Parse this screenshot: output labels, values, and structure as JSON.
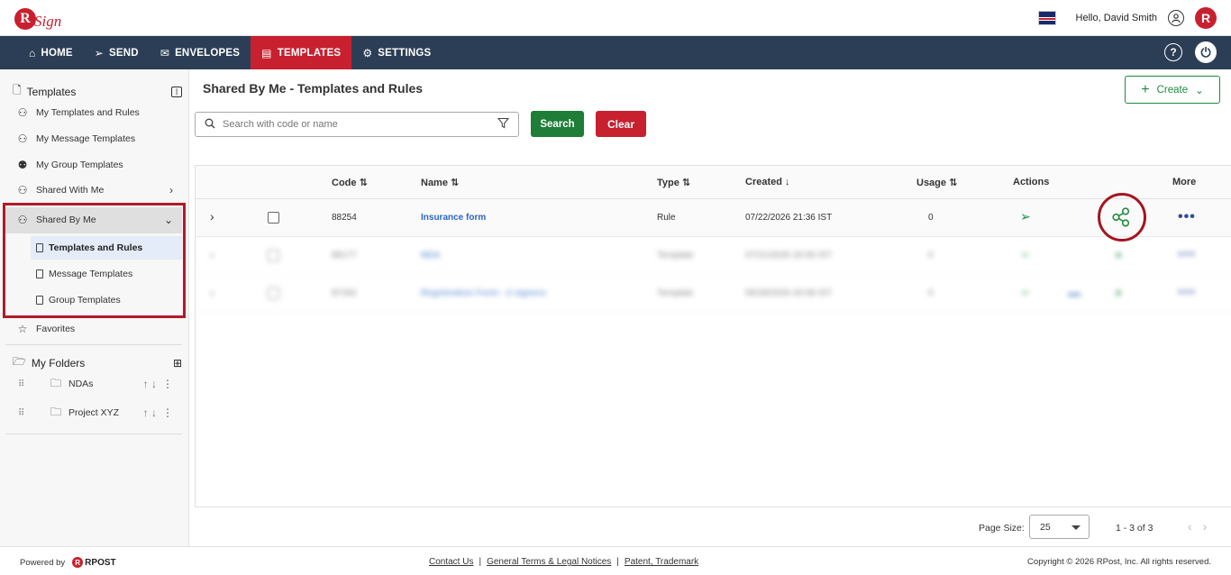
{
  "header": {
    "logo_text": "Sign",
    "logo_letter": "R",
    "greeting": "Hello, David Smith",
    "brand_letter": "R"
  },
  "nav": {
    "items": [
      {
        "label": "HOME",
        "icon": "home-icon"
      },
      {
        "label": "SEND",
        "icon": "send-icon"
      },
      {
        "label": "ENVELOPES",
        "icon": "envelope-icon"
      },
      {
        "label": "TEMPLATES",
        "icon": "document-icon",
        "active": true
      },
      {
        "label": "SETTINGS",
        "icon": "gear-icon"
      }
    ],
    "help_symbol": "?",
    "power_symbol": "⏻"
  },
  "sidebar": {
    "title": "Templates",
    "items": [
      {
        "label": "My Templates and Rules"
      },
      {
        "label": "My Message Templates"
      },
      {
        "label": "My Group Templates"
      },
      {
        "label": "Shared With Me"
      },
      {
        "label": "Shared By Me",
        "expanded": true
      }
    ],
    "sub_items": [
      {
        "label": "Templates and Rules",
        "active": true
      },
      {
        "label": "Message Templates"
      },
      {
        "label": "Group Templates"
      }
    ],
    "favorites": "Favorites",
    "folders_title": "My Folders",
    "folders": [
      {
        "name": "NDAs"
      },
      {
        "name": "Project XYZ"
      }
    ]
  },
  "main": {
    "title": "Shared By Me - Templates and Rules",
    "create_label": "Create",
    "search_placeholder": "Search with code or name",
    "search_label": "Search",
    "clear_label": "Clear"
  },
  "table": {
    "headers": {
      "code": "Code",
      "name": "Name",
      "type": "Type",
      "created": "Created",
      "usage": "Usage",
      "actions": "Actions",
      "more": "More"
    },
    "rows": [
      {
        "code": "88254",
        "name": "Insurance form",
        "type": "Rule",
        "created": "07/22/2026 21:36 IST",
        "usage": "0"
      },
      {
        "code": "88177",
        "name": "NDA",
        "type": "Template",
        "created": "07/21/2026 20:05 IST",
        "usage": "0"
      },
      {
        "code": "87292",
        "name": "Registration Form - 2 signers",
        "type": "Template",
        "created": "06/28/2026 20:08 IST",
        "usage": "0"
      }
    ]
  },
  "pager": {
    "page_size_label": "Page Size:",
    "page_size": "25",
    "count": "1 - 3 of 3"
  },
  "footer": {
    "powered_by": "Powered by",
    "rpost": "RPOST",
    "links": [
      "Contact Us",
      "General Terms & Legal Notices",
      "Patent, Trademark"
    ],
    "copyright": "Copyright © 2026 RPost, Inc. All rights reserved."
  }
}
